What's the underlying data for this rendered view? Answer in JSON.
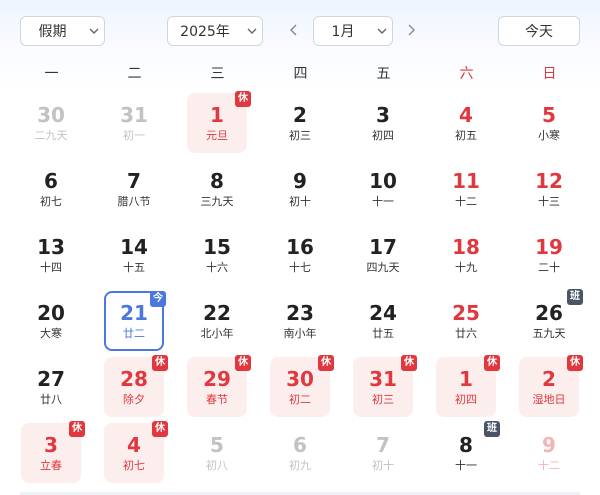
{
  "toolbar": {
    "holiday_select": "假期",
    "year_select": "2025年",
    "month_select": "1月",
    "today_label": "今天"
  },
  "colors": {
    "accent": "#4a78e0",
    "holiday_red": "#e0383e",
    "rest_bg": "#fdeeee",
    "work_badge": "#4a5568"
  },
  "icons": {
    "dropdown": "chevron-down-icon",
    "prev": "chevron-left-icon",
    "next": "chevron-right-icon"
  },
  "weekdays": [
    {
      "label": "一",
      "weekend": false
    },
    {
      "label": "二",
      "weekend": false
    },
    {
      "label": "三",
      "weekend": false
    },
    {
      "label": "四",
      "weekend": false
    },
    {
      "label": "五",
      "weekend": false
    },
    {
      "label": "六",
      "weekend": true
    },
    {
      "label": "日",
      "weekend": true
    }
  ],
  "days": [
    {
      "num": "30",
      "lunar": "二九天",
      "dim": true
    },
    {
      "num": "31",
      "lunar": "初一",
      "dim": true
    },
    {
      "num": "1",
      "lunar": "元旦",
      "rest": true,
      "badge": "休"
    },
    {
      "num": "2",
      "lunar": "初三"
    },
    {
      "num": "3",
      "lunar": "初四"
    },
    {
      "num": "4",
      "lunar": "初五",
      "weekend": true
    },
    {
      "num": "5",
      "lunar": "小寒",
      "weekend": true
    },
    {
      "num": "6",
      "lunar": "初七"
    },
    {
      "num": "7",
      "lunar": "腊八节"
    },
    {
      "num": "8",
      "lunar": "三九天"
    },
    {
      "num": "9",
      "lunar": "初十"
    },
    {
      "num": "10",
      "lunar": "十一"
    },
    {
      "num": "11",
      "lunar": "十二",
      "weekend": true
    },
    {
      "num": "12",
      "lunar": "十三",
      "weekend": true
    },
    {
      "num": "13",
      "lunar": "十四"
    },
    {
      "num": "14",
      "lunar": "十五"
    },
    {
      "num": "15",
      "lunar": "十六"
    },
    {
      "num": "16",
      "lunar": "十七"
    },
    {
      "num": "17",
      "lunar": "四九天"
    },
    {
      "num": "18",
      "lunar": "十九",
      "weekend": true
    },
    {
      "num": "19",
      "lunar": "二十",
      "weekend": true
    },
    {
      "num": "20",
      "lunar": "大寒"
    },
    {
      "num": "21",
      "lunar": "廿二",
      "today": true,
      "badge": "今"
    },
    {
      "num": "22",
      "lunar": "北小年"
    },
    {
      "num": "23",
      "lunar": "南小年"
    },
    {
      "num": "24",
      "lunar": "廿五"
    },
    {
      "num": "25",
      "lunar": "廿六",
      "weekend": true
    },
    {
      "num": "26",
      "lunar": "五九天",
      "work": true,
      "badge": "班"
    },
    {
      "num": "27",
      "lunar": "廿八"
    },
    {
      "num": "28",
      "lunar": "除夕",
      "rest": true,
      "badge": "休"
    },
    {
      "num": "29",
      "lunar": "春节",
      "rest": true,
      "badge": "休"
    },
    {
      "num": "30",
      "lunar": "初二",
      "rest": true,
      "badge": "休"
    },
    {
      "num": "31",
      "lunar": "初三",
      "rest": true,
      "badge": "休"
    },
    {
      "num": "1",
      "lunar": "初四",
      "rest": true,
      "badge": "休"
    },
    {
      "num": "2",
      "lunar": "湿地日",
      "rest": true,
      "badge": "休"
    },
    {
      "num": "3",
      "lunar": "立春",
      "rest": true,
      "badge": "休"
    },
    {
      "num": "4",
      "lunar": "初七",
      "rest": true,
      "badge": "休"
    },
    {
      "num": "5",
      "lunar": "初八",
      "dim": true
    },
    {
      "num": "6",
      "lunar": "初九",
      "dim": true
    },
    {
      "num": "7",
      "lunar": "初十",
      "dim": true
    },
    {
      "num": "8",
      "lunar": "十一",
      "work": true,
      "badge": "班"
    },
    {
      "num": "9",
      "lunar": "十二",
      "dim": true,
      "weekend": true
    }
  ]
}
